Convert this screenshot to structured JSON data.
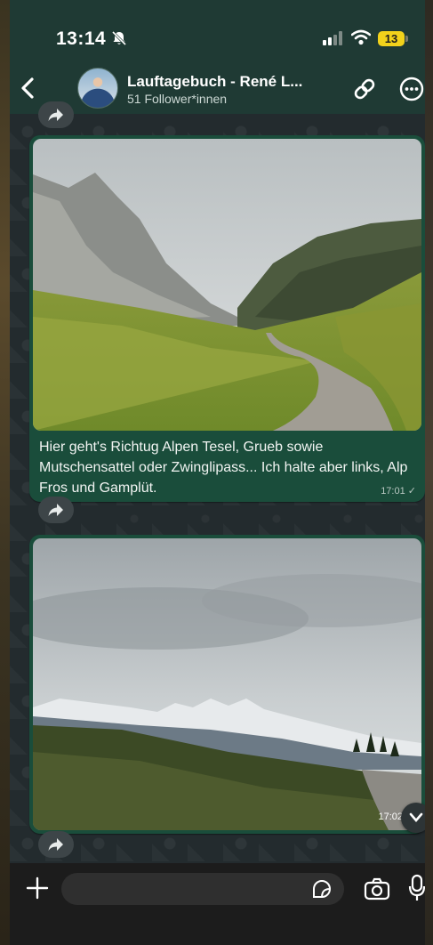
{
  "status_bar": {
    "time": "13:14",
    "battery": "13"
  },
  "header": {
    "back_icon": "chevron-left-icon",
    "title": "Lauftagebuch - René L...",
    "subtitle": "51 Follower*innen",
    "link_icon": "link-icon",
    "menu_icon": "more-icon"
  },
  "messages": [
    {
      "caption": "Hier geht's Richtug Alpen Tesel, Grueb sowie Mutschensattel oder Zwinglipass... Ich halte aber links, Alp Fros und Gamplüt.",
      "time": "17:01",
      "status": "✓"
    },
    {
      "time": "17:02"
    }
  ],
  "input": {
    "placeholder": ""
  },
  "colors": {
    "header_bg": "#1f3a34",
    "bubble_bg": "#1a4d3b",
    "battery": "#f2d21b"
  }
}
